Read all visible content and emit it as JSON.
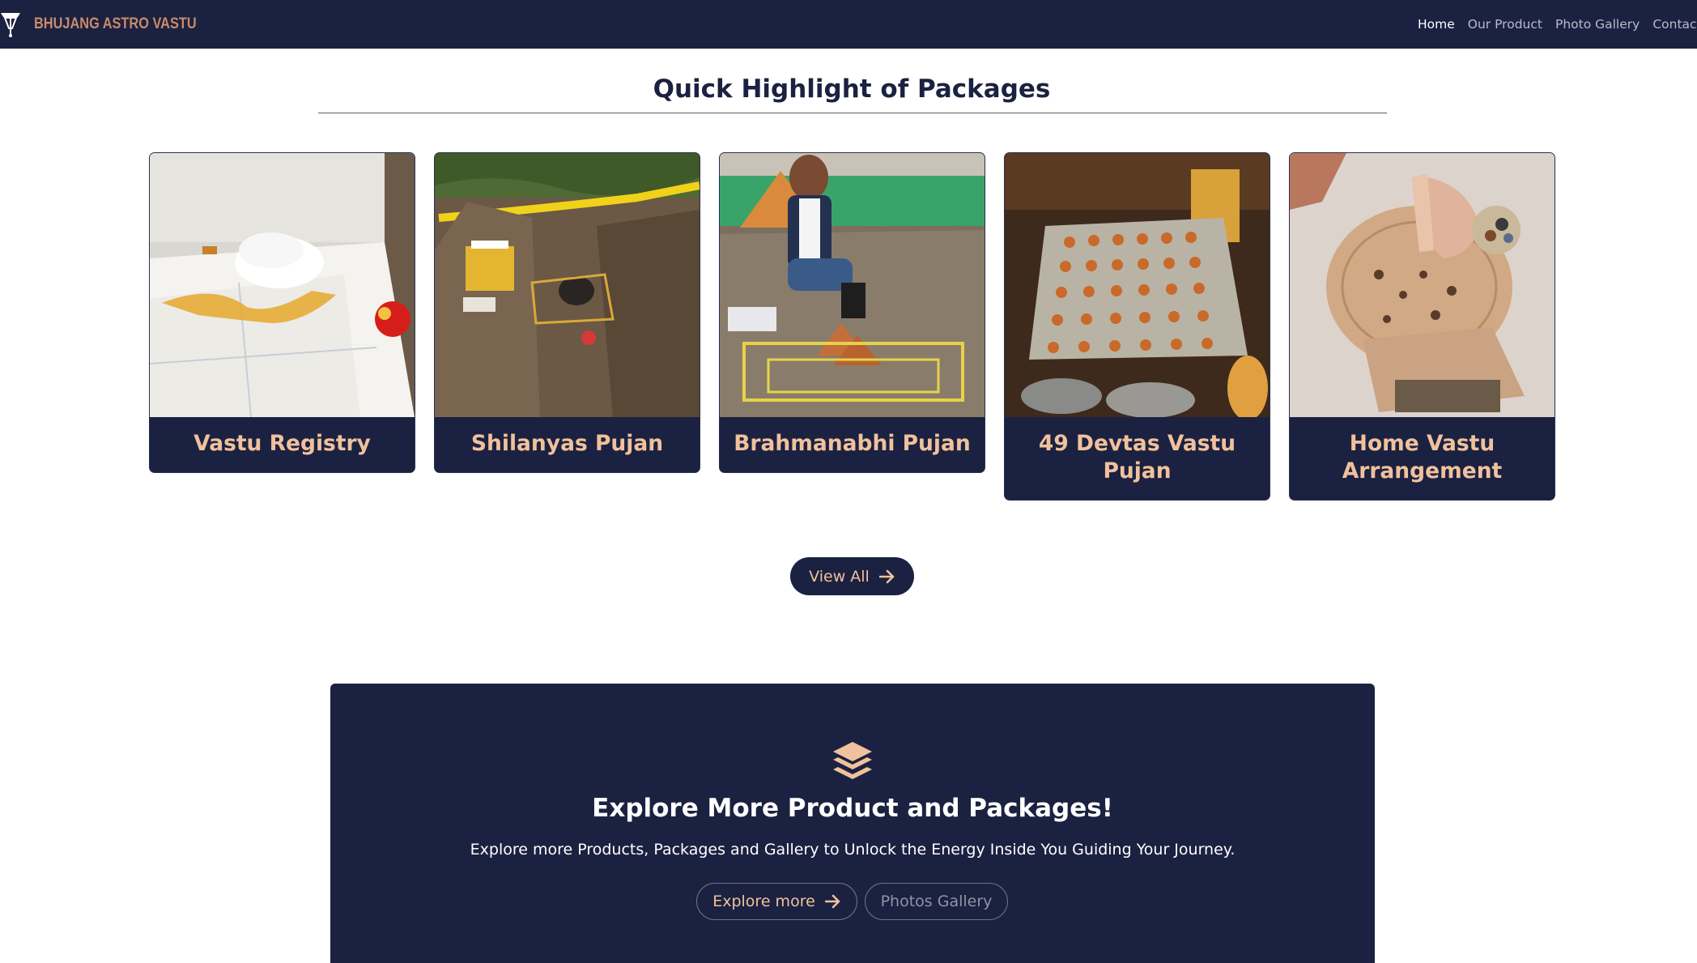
{
  "navbar": {
    "brand": "BHUJANG ASTRO VASTU",
    "links": [
      {
        "label": "Home",
        "active": true
      },
      {
        "label": "Our Product",
        "active": false
      },
      {
        "label": "Photo Gallery",
        "active": false
      },
      {
        "label": "Contact Us",
        "active": false
      }
    ]
  },
  "highlights": {
    "title": "Quick Highlight of Packages",
    "cards": [
      {
        "label": "Vastu Registry",
        "image": "vastu-registry-photo"
      },
      {
        "label": "Shilanyas Pujan",
        "image": "shilanyas-pujan-photo"
      },
      {
        "label": "Brahmanabhi Pujan",
        "image": "brahmanabhi-pujan-photo"
      },
      {
        "label": "49 Devtas Vastu Pujan",
        "image": "devtas-vastu-pujan-photo"
      },
      {
        "label": "Home Vastu Arrangement",
        "image": "home-vastu-arrangement-photo"
      }
    ],
    "view_all_label": "View All"
  },
  "explore": {
    "icon": "layers-icon",
    "title": "Explore More Product and Packages!",
    "text": "Explore more Products, Packages and Gallery to Unlock the Energy Inside You Guiding Your Journey.",
    "explore_label": "Explore more",
    "gallery_label": "Photos Gallery"
  },
  "colors": {
    "navy": "#1b2140",
    "accent": "#f0c19c",
    "brand": "#c98a6b"
  }
}
